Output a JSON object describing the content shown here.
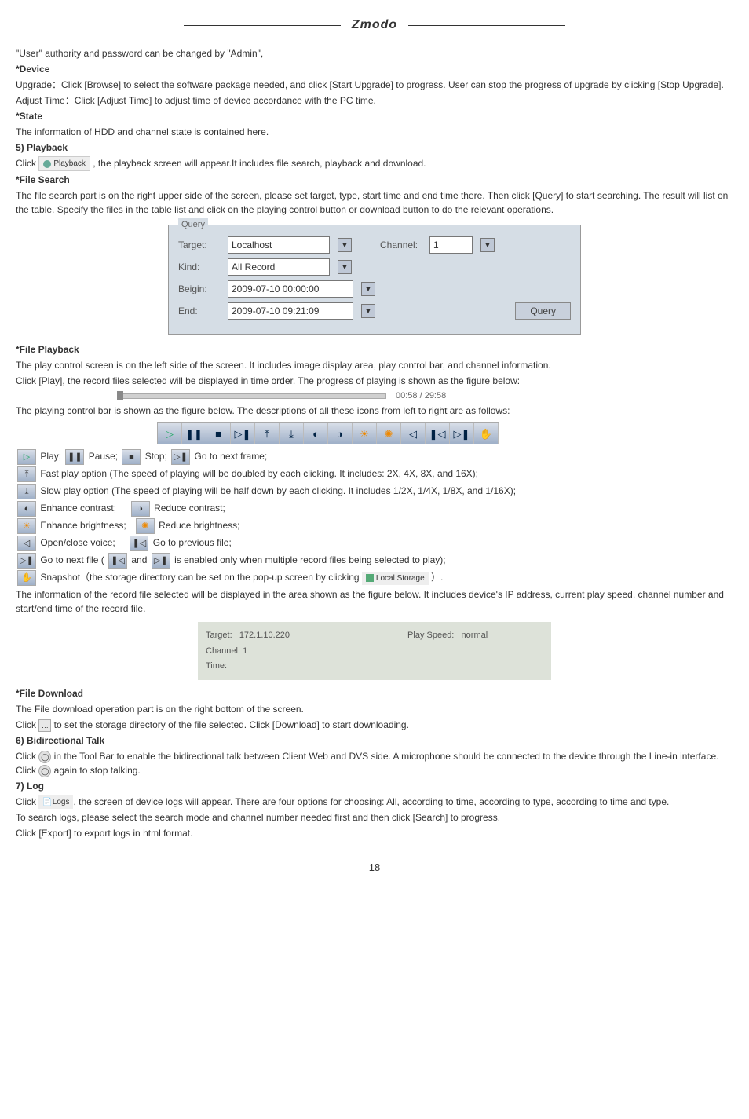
{
  "logo": "Zmodo",
  "intro_user_auth": "\"User\" authority and password can be changed by \"Admin\",",
  "device_heading": "*Device",
  "device_upgrade": "Upgrade：Click [Browse] to select the software package needed, and click [Start Upgrade] to progress. User can stop the progress of upgrade by clicking [Stop Upgrade].",
  "device_adjust": "Adjust Time：Click [Adjust Time] to adjust time of device accordance with the PC time.",
  "state_heading": "*State",
  "state_info": "The information of HDD and channel state is contained here.",
  "playback_heading": "5) Playback",
  "playback_click": "Click ",
  "playback_chip_label": "Playback",
  "playback_click_tail": " , the playback screen will appear.It includes file search, playback and download.",
  "file_search_heading": "*File Search",
  "file_search_body": "The file search part is on the right upper side of the screen, please set target, type, start time and end time there. Then click [Query] to start searching. The result will list on the table. Specify the files in the table list and click on the playing control button or download button to do the relevant operations.",
  "query": {
    "legend": "Query",
    "target_label": "Target:",
    "target_value": "Localhost",
    "channel_label": "Channel:",
    "channel_value": "1",
    "kind_label": "Kind:",
    "kind_value": "All Record",
    "begin_label": "Beigin:",
    "begin_value": "2009-07-10 00:00:00",
    "end_label": "End:",
    "end_value": "2009-07-10 09:21:09",
    "query_btn": "Query"
  },
  "file_playback_heading": "*File Playback",
  "file_playback_p1": "The play control screen is on the left side of the screen. It includes image display area, play control bar, and channel information.",
  "file_playback_p2": "Click [Play], the record files selected will be displayed in time order. The progress of playing is shown as the figure below:",
  "timecode": "00:58 / 29:58",
  "file_playback_p3": "The playing control bar is shown as the figure below. The descriptions of all these icons from left to right are as follows:",
  "icons_row1": {
    "play": "Play;",
    "pause": "Pause;",
    "stop": "Stop;",
    "next_frame": "Go to next frame;"
  },
  "fast_play": "Fast play option (The speed of playing will be doubled by each clicking. It includes: 2X, 4X, 8X, and 16X);",
  "slow_play": "Slow play option (The speed of playing will be half down by each clicking. It includes 1/2X, 1/4X, 1/8X, and 1/16X);",
  "enhance_contrast": "Enhance contrast;",
  "reduce_contrast": "Reduce contrast;",
  "enhance_brightness": "Enhance brightness;",
  "reduce_brightness": "Reduce brightness;",
  "open_close_voice": "Open/close voice;",
  "go_prev_file": "Go to previous file;",
  "go_next_file_a": "Go to next file ( ",
  "go_next_file_b": " and ",
  "go_next_file_c": " is enabled only when multiple record files being selected to play);",
  "snapshot_a": "Snapshot（the storage directory can be set on the pop-up screen by clicking ",
  "local_storage_chip": "Local Storage",
  "snapshot_b": " ）.",
  "record_info": "The information of the record file selected will be displayed in the area shown as the figure below. It includes device's IP address, current play speed, channel number and start/end time of the record file.",
  "info_panel": {
    "target_label": "Target:",
    "target_value": "172.1.10.220",
    "speed_label": "Play Speed:",
    "speed_value": "normal",
    "channel_label": "Channel:",
    "channel_value": "1",
    "time_label": "Time:"
  },
  "file_download_heading": "*File Download",
  "file_download_p1": "The File download operation part is on the right bottom of the screen.",
  "file_download_p2a": "Click ",
  "file_download_p2b": " to set the storage directory of the file selected. Click [Download] to start downloading.",
  "bidir_heading": "6) Bidirectional Talk",
  "bidir_p1a": "Click ",
  "bidir_p1b": " in the Tool Bar to enable the bidirectional talk between Client Web and DVS side. A microphone should be connected to the device through the Line-in interface. Click ",
  "bidir_p1c": " again to stop talking.",
  "log_heading": "7) Log",
  "log_p1a": "Click ",
  "logs_chip": "Logs",
  "log_p1b": ", the screen of device logs will appear. There are four options for choosing: All, according to time, according to type, according to time and type.",
  "log_p2": "To search logs, please select the search mode and channel number needed first and then click [Search] to progress.",
  "log_p3": "Click [Export] to export logs in html format.",
  "page_number": "18"
}
